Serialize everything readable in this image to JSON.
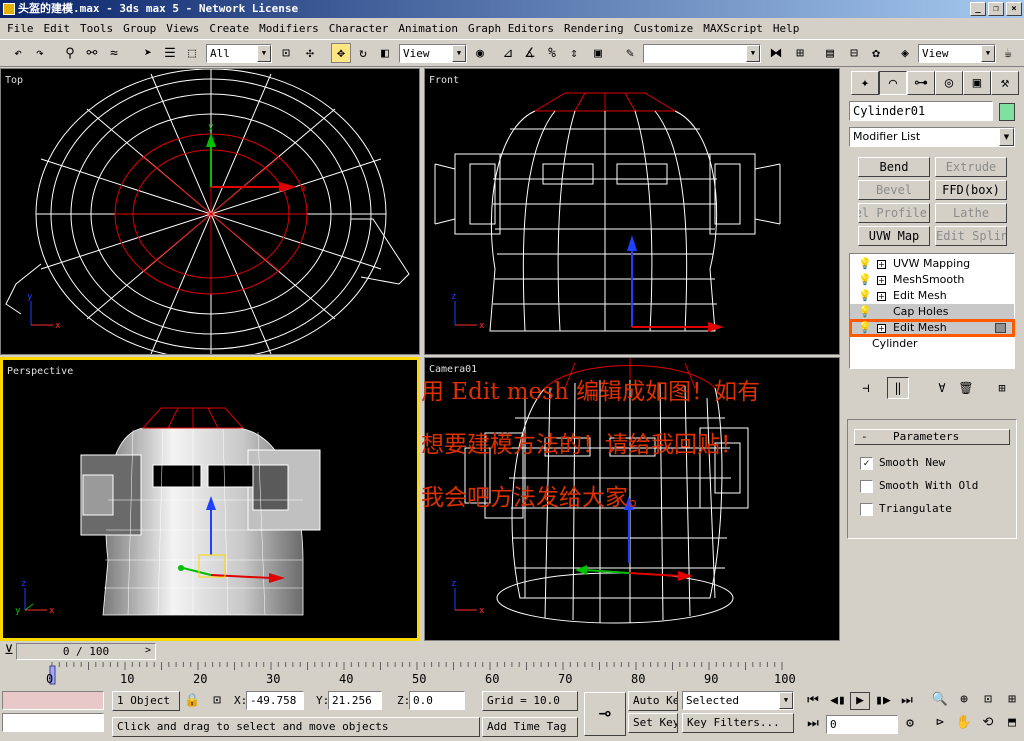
{
  "window": {
    "title": "头盔的建模.max - 3ds max 5 - Network License"
  },
  "menu": [
    "File",
    "Edit",
    "Tools",
    "Group",
    "Views",
    "Create",
    "Modifiers",
    "Character",
    "Animation",
    "Graph Editors",
    "Rendering",
    "Customize",
    "MAXScript",
    "Help"
  ],
  "toolbar": {
    "selection_filter": "All",
    "ref_coord": "View",
    "named_sel": "",
    "view_combo": "View",
    "icons": [
      "undo-icon",
      "redo-icon",
      "select-icon",
      "select-by-name-icon",
      "rect-select-icon",
      "window-crossing-icon",
      "link-icon",
      "move-icon",
      "rotate-icon",
      "scale-icon",
      "mirror-icon",
      "align-icon",
      "material-editor-icon",
      "render-scene-icon",
      "quick-render-icon"
    ]
  },
  "viewports": {
    "top": {
      "label": "Top"
    },
    "front": {
      "label": "Front"
    },
    "perspective": {
      "label": "Perspective"
    },
    "camera": {
      "label": "Camera01"
    }
  },
  "axis_letters": {
    "x": "x",
    "y": "y",
    "z": "z"
  },
  "overlay_text": [
    "用 Edit mesh 编辑成如图！如有",
    "想要建模方法的！请给我回贴！",
    "我会吧方法发给大家。"
  ],
  "command_panel": {
    "object_name": "Cylinder01",
    "object_color": "#80e0a0",
    "modifier_list": "Modifier List",
    "modifier_buttons": [
      {
        "label": "Bend",
        "enabled": true
      },
      {
        "label": "Extrude",
        "enabled": false
      },
      {
        "label": "Bevel",
        "enabled": false
      },
      {
        "label": "FFD(box)",
        "enabled": true
      },
      {
        "label": "Bevel Profile",
        "enabled": false
      },
      {
        "label": "Lathe",
        "enabled": false
      },
      {
        "label": "UVW Map",
        "enabled": true
      },
      {
        "label": "Edit Spline",
        "enabled": false
      }
    ],
    "stack": [
      {
        "label": "UVW Mapping",
        "expandable": true
      },
      {
        "label": "MeshSmooth",
        "expandable": true
      },
      {
        "label": "Edit Mesh",
        "expandable": true
      },
      {
        "label": "Cap Holes",
        "expandable": false
      },
      {
        "label": "Edit Mesh",
        "expandable": true,
        "highlighted": true
      },
      {
        "label": "Cylinder",
        "expandable": false
      }
    ],
    "parameters": {
      "title": "Parameters",
      "collapse": "-",
      "options": [
        {
          "label": "Smooth New",
          "checked": true
        },
        {
          "label": "Smooth With Old",
          "checked": false
        },
        {
          "label": "Triangulate",
          "checked": false
        }
      ]
    }
  },
  "timeline": {
    "frame_display": "0 / 100",
    "ticks": [
      "0",
      "10",
      "20",
      "30",
      "40",
      "50",
      "60",
      "70",
      "80",
      "90",
      "100"
    ]
  },
  "status": {
    "selection": "1 Object",
    "x_label": "X:",
    "x": "-49.758",
    "y_label": "Y:",
    "y": "21.256",
    "z_label": "Z:",
    "z": "0.0",
    "grid": "Grid = 10.0",
    "auto_key": "Auto Key",
    "set_key": "Set Key",
    "key_mode": "Selected",
    "key_filters": "Key Filters...",
    "frame": "0",
    "prompt": "Click and drag to select and move objects",
    "add_time_tag": "Add Time Tag"
  },
  "colors": {
    "wire": "#ffffff",
    "selected_wire": "#e00000",
    "viewport_bg": "#000000",
    "active_border": "#ffd800",
    "highlight": "#ff5a00",
    "overlay": "#dd3000"
  }
}
